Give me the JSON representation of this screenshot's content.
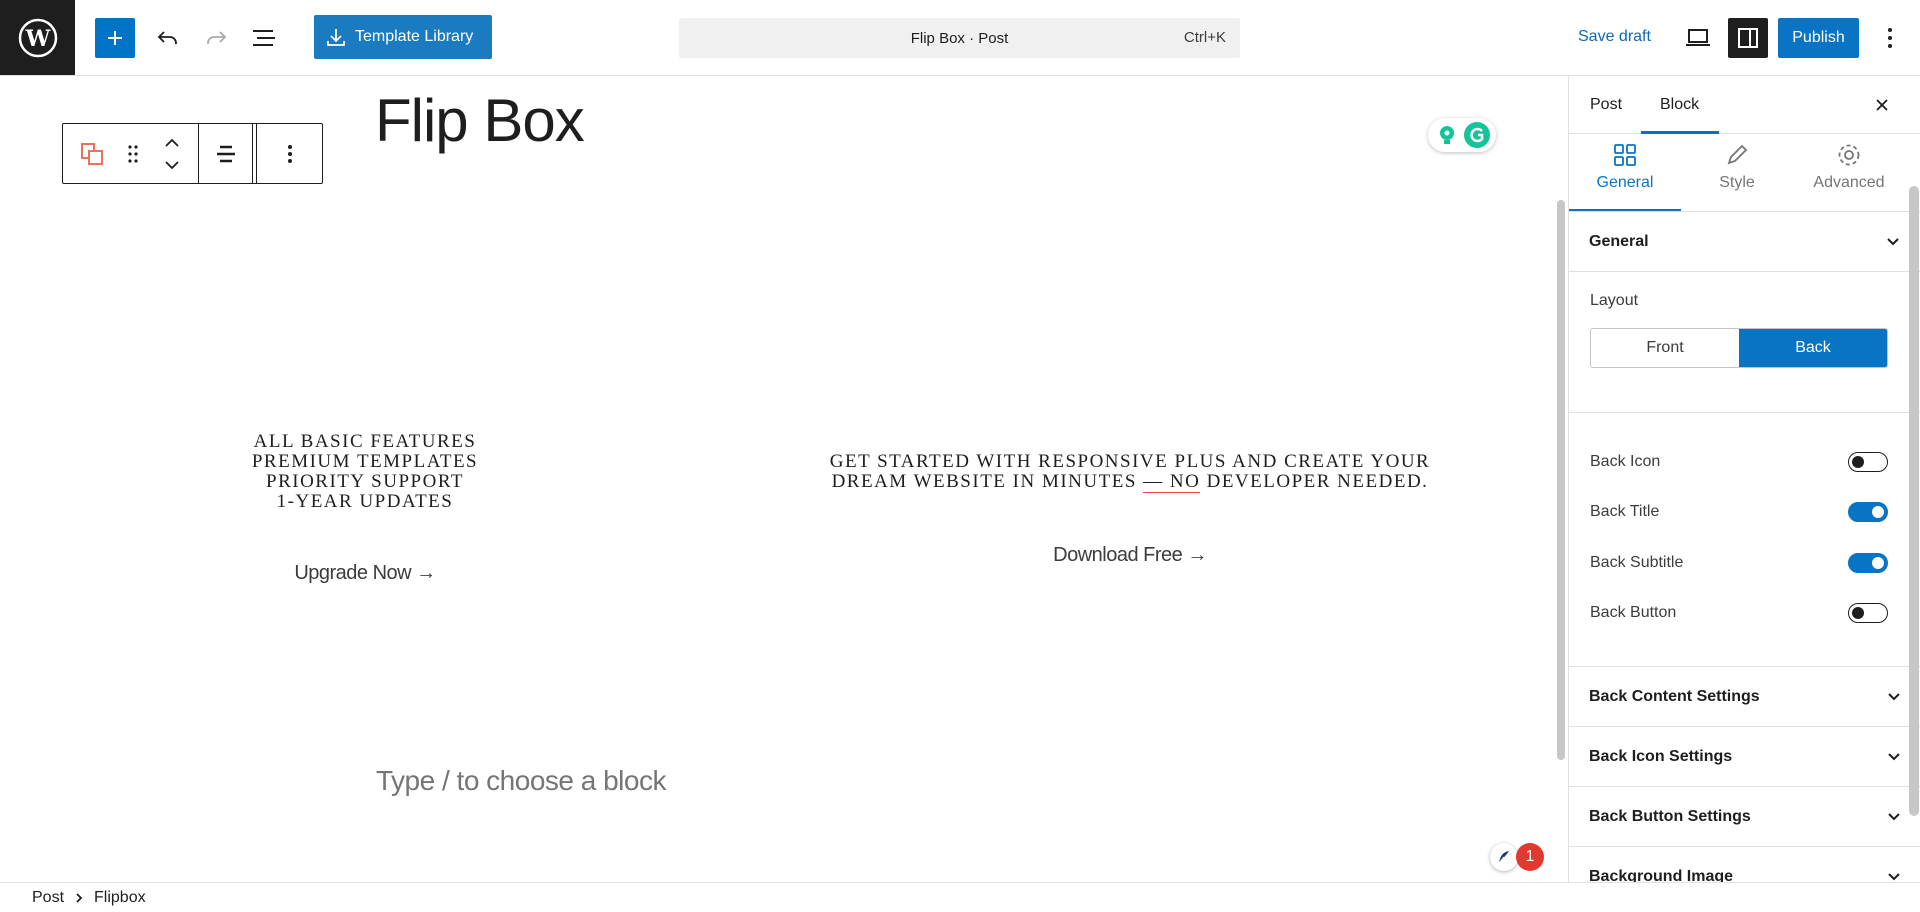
{
  "toolbar": {
    "template_library_label": "Template Library",
    "command_bar_title": "Flip Box · Post",
    "command_bar_shortcut": "Ctrl+K",
    "save_draft_label": "Save draft",
    "publish_label": "Publish"
  },
  "editor": {
    "post_title": "Flip Box",
    "placeholder": "Type / to choose a block",
    "flipbox_left": {
      "lines": [
        "ALL BASIC FEATURES",
        "PREMIUM TEMPLATES",
        "PRIORITY SUPPORT",
        "1-YEAR UPDATES"
      ],
      "button": "Upgrade Now →"
    },
    "flipbox_right": {
      "line1": "GET STARTED WITH RESPONSIVE PLUS AND CREATE YOUR",
      "line2_pre": "DREAM WEBSITE IN MINUTES ",
      "line2_underlined": "— NO",
      "line2_post": " DEVELOPER NEEDED.",
      "button": "Download Free →"
    },
    "notification_count": "1"
  },
  "sidebar": {
    "tabs": {
      "post": "Post",
      "block": "Block"
    },
    "sub_tabs": {
      "general": "General",
      "style": "Style",
      "advanced": "Advanced"
    },
    "general_panel_title": "General",
    "layout_label": "Layout",
    "layout_options": {
      "front": "Front",
      "back": "Back",
      "selected": "Back"
    },
    "toggles": [
      {
        "label": "Back Icon",
        "on": false
      },
      {
        "label": "Back Title",
        "on": true
      },
      {
        "label": "Back Subtitle",
        "on": true
      },
      {
        "label": "Back Button",
        "on": false
      }
    ],
    "sections": [
      "Back Content Settings",
      "Back Icon Settings",
      "Back Button Settings",
      "Background Image"
    ]
  },
  "breadcrumb": {
    "root": "Post",
    "current": "Flipbox"
  },
  "colors": {
    "accent": "#0a74c4",
    "dark": "#1e1e1e",
    "notification": "#e2382f",
    "grammarly": "#15c39a"
  }
}
